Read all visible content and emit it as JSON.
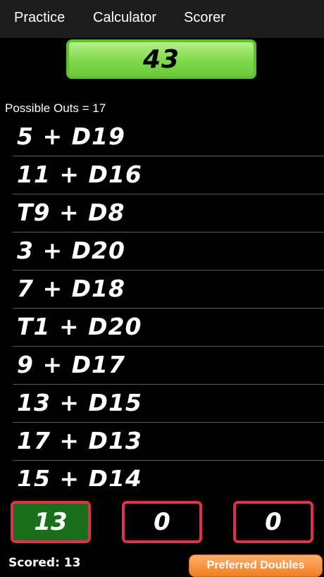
{
  "nav": {
    "tabs": [
      {
        "label": "Practice"
      },
      {
        "label": "Calculator"
      },
      {
        "label": "Scorer"
      }
    ]
  },
  "score": {
    "value": "43"
  },
  "outs": {
    "heading": "Possible Outs = 17",
    "items": [
      "5 + D19",
      "11 + D16",
      "T9 + D8",
      "3 + D20",
      "7 + D18",
      "T1 + D20",
      "9 + D17",
      "13 + D15",
      "17 + D13",
      "15 + D14"
    ]
  },
  "darts": [
    {
      "value": "13",
      "active": true
    },
    {
      "value": "0",
      "active": false
    },
    {
      "value": "0",
      "active": false
    }
  ],
  "footer": {
    "scored_label": "Scored: 13",
    "preferred_button": "Preferred Doubles"
  },
  "colors": {
    "score_green": "#7fd84c",
    "dart_border_red": "#e0304d",
    "active_dart_green": "#1a6f1a",
    "button_orange": "#f07e22"
  }
}
